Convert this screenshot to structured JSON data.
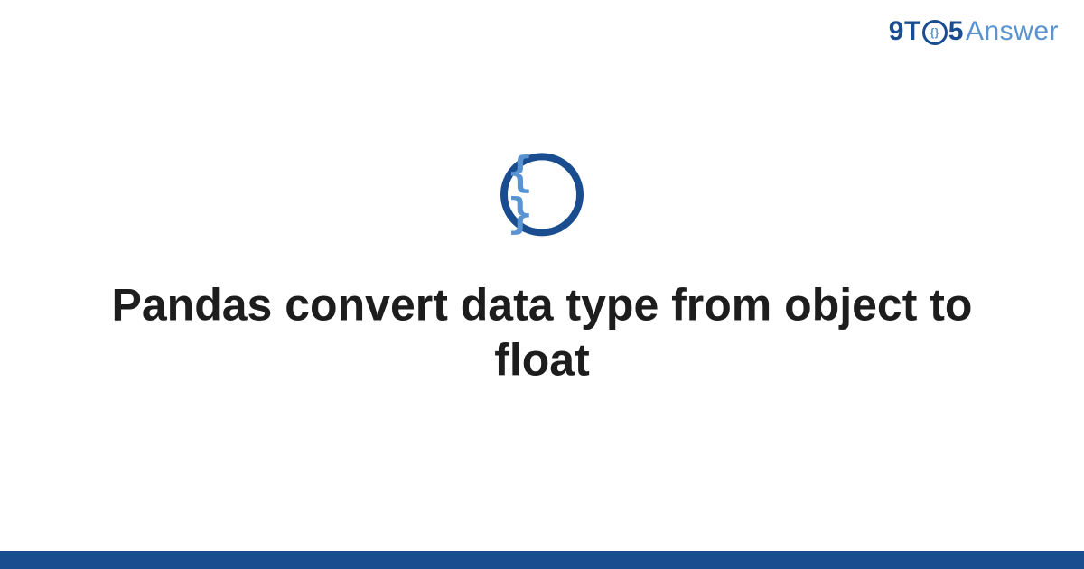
{
  "brand": {
    "nine": "9",
    "t": "T",
    "o_inner": "{}",
    "five": "5",
    "answer": "Answer"
  },
  "icon": {
    "braces": "{ }",
    "name": "code-braces-icon"
  },
  "title": "Pandas convert data type from object to float",
  "colors": {
    "primary": "#1a4d8f",
    "accent": "#5a93d1",
    "text": "#1d1d1d"
  }
}
